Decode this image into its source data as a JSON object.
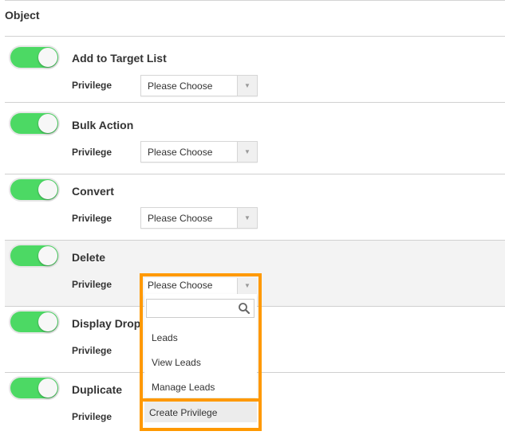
{
  "section": {
    "title": "Object"
  },
  "rows": [
    {
      "title": "Add to Target List",
      "enabled": true,
      "privilege_label": "Privilege",
      "select_value": "Please Choose"
    },
    {
      "title": "Bulk Action",
      "enabled": true,
      "privilege_label": "Privilege",
      "select_value": "Please Choose"
    },
    {
      "title": "Convert",
      "enabled": true,
      "privilege_label": "Privilege",
      "select_value": "Please Choose"
    },
    {
      "title": "Delete",
      "enabled": true,
      "privilege_label": "Privilege",
      "select_value": "Please Choose"
    },
    {
      "title": "Display Drop",
      "enabled": true,
      "privilege_label": "Privilege",
      "select_value": ""
    },
    {
      "title": "Duplicate",
      "enabled": true,
      "privilege_label": "Privilege",
      "select_value": ""
    }
  ],
  "dropdown": {
    "selected": "Please Choose",
    "search_value": "",
    "options": [
      "Leads",
      "View Leads",
      "Manage Leads"
    ],
    "create_label": "Create Privilege"
  },
  "colors": {
    "toggle_on": "#4cd964",
    "highlight": "#ff9900",
    "active_row_bg": "#f3f3f3"
  }
}
